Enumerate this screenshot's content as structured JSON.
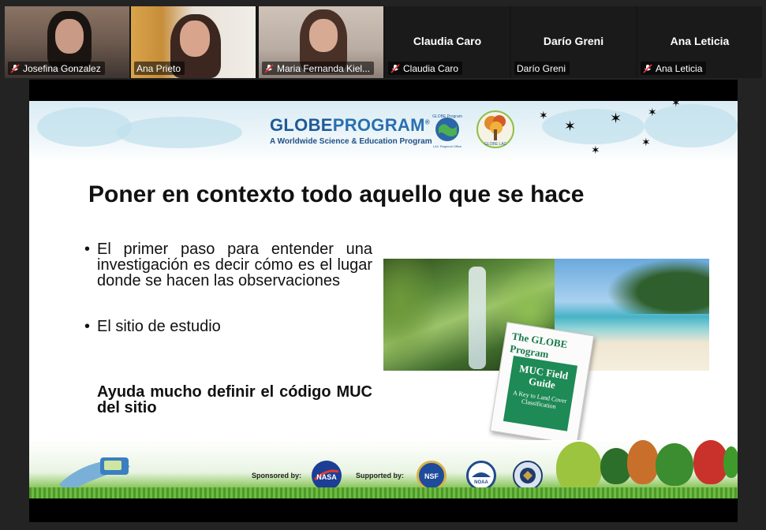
{
  "participants": [
    {
      "name": "Josefina Gonzalez",
      "muted": true,
      "video": true,
      "active": false
    },
    {
      "name": "Ana Prieto",
      "muted": false,
      "video": true,
      "active": true
    },
    {
      "name": "Maria Fernanda Kiel...",
      "muted": true,
      "video": true,
      "active": false
    },
    {
      "name": "Claudia Caro",
      "display_name": "Claudia Caro",
      "muted": true,
      "video": false,
      "active": false
    },
    {
      "name": "Darío Greni",
      "display_name": "Darío Greni",
      "muted": false,
      "video": false,
      "active": false
    },
    {
      "name": "Ana Leticia",
      "display_name": "Ana Leticia",
      "muted": true,
      "video": false,
      "active": false
    }
  ],
  "slide": {
    "header": {
      "logo_title_a": "GLOBE",
      "logo_title_b": "PROGRAM",
      "logo_reg": "®",
      "logo_subtitle": "A Worldwide Science & Education Program",
      "badge_text": "GLOBE Program",
      "badge_sub": "LAC Regional Office",
      "tree_badge_text": "GLOBE LAC"
    },
    "title": "Poner en contexto todo aquello que se hace",
    "bullets": [
      "El primer paso para entender una investigación es decir cómo es el lugar donde se hacen las observaciones",
      "El sitio de estudio"
    ],
    "bold_note": "Ayuda mucho definir el código MUC del sitio",
    "guide": {
      "top": "The GLOBE Program",
      "title": "MUC Field Guide",
      "subtitle": "A Key to Land Cover Classification"
    },
    "footer": {
      "sponsored_by": "Sponsored by:",
      "supported_by": "Supported by:",
      "seal_nasa": "NASA",
      "seal_nsf": "NSF",
      "seal_noaa": "NOAA"
    }
  },
  "colors": {
    "active_speaker": "#23d959",
    "globe_blue": "#1f5a96",
    "guide_green": "#1e8a55"
  }
}
